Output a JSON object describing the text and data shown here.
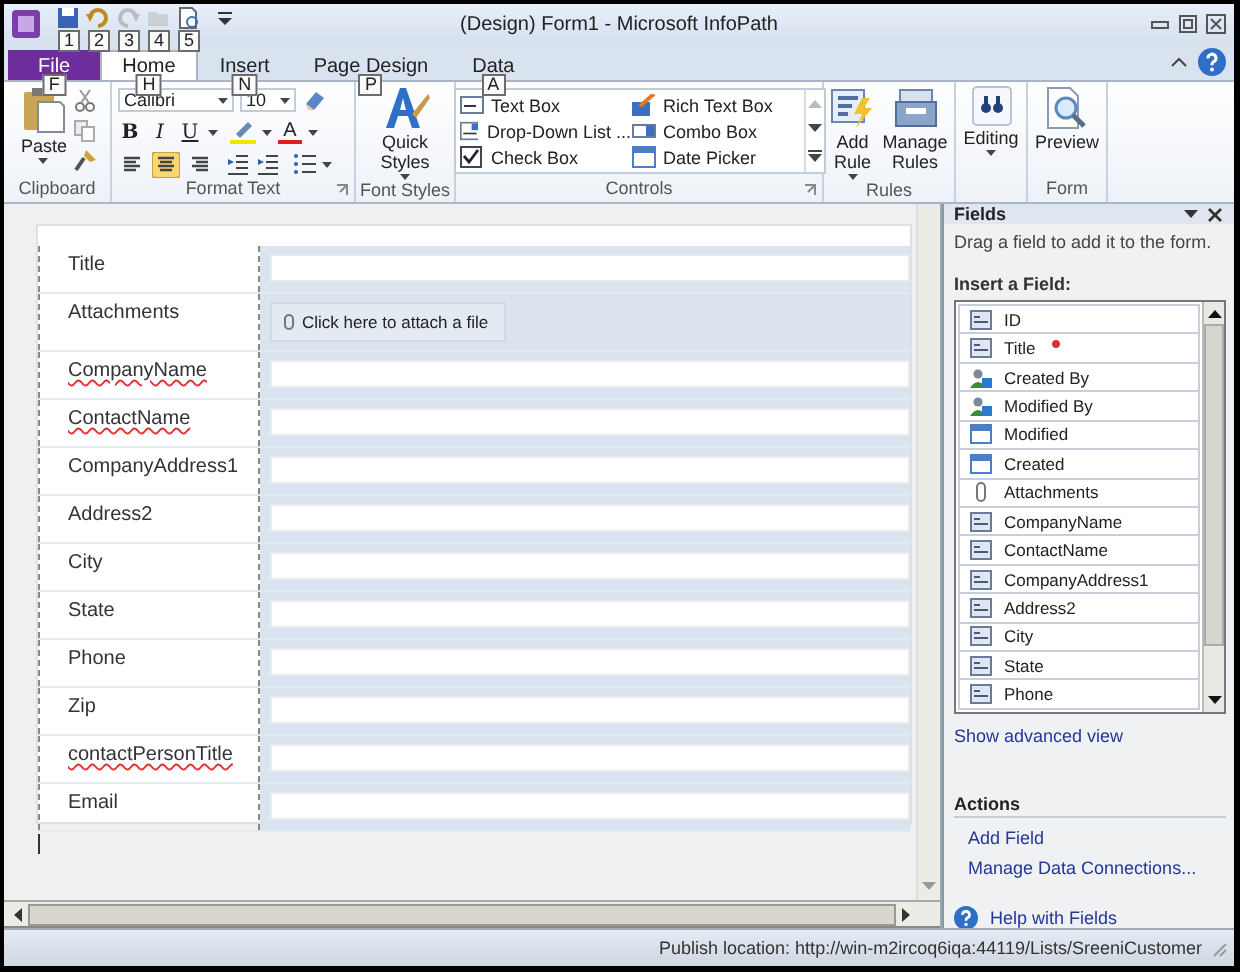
{
  "window": {
    "title": "(Design) Form1 - Microsoft InfoPath"
  },
  "quick_access": [
    {
      "kind": "save",
      "keytip": "1",
      "disabled": false
    },
    {
      "kind": "undo",
      "keytip": "2",
      "disabled": false
    },
    {
      "kind": "redo",
      "keytip": "3",
      "disabled": true
    },
    {
      "kind": "open",
      "keytip": "4",
      "disabled": true
    },
    {
      "kind": "preview",
      "keytip": "5",
      "disabled": false
    }
  ],
  "tabs": [
    {
      "label": "File",
      "keytip": "F",
      "kind": "file",
      "selected": false
    },
    {
      "label": "Home",
      "keytip": "H",
      "kind": "tab",
      "selected": true
    },
    {
      "label": "Insert",
      "keytip": "N",
      "kind": "tab",
      "selected": false
    },
    {
      "label": "Page Design",
      "keytip": "P",
      "kind": "tab",
      "selected": false
    },
    {
      "label": "Data",
      "keytip": "A",
      "kind": "tab",
      "selected": false
    }
  ],
  "clipboard": {
    "label": "Clipboard",
    "paste": "Paste"
  },
  "format_text": {
    "label": "Format Text",
    "font": "Calibri",
    "size": "10",
    "bold": "B",
    "italic": "I",
    "underline": "U",
    "font_color": "A",
    "align": [
      {
        "selected": false
      },
      {
        "selected": true
      },
      {
        "selected": false
      }
    ]
  },
  "font_styles": {
    "label": "Font Styles",
    "button": "Quick Styles"
  },
  "controls": {
    "label": "Controls",
    "items": [
      {
        "label": "Text Box",
        "kind": "text"
      },
      {
        "label": "Rich Text Box",
        "kind": "rich"
      },
      {
        "label": "Drop-Down List ...",
        "kind": "dropdown"
      },
      {
        "label": "Combo Box",
        "kind": "combo"
      },
      {
        "label": "Check Box",
        "kind": "check"
      },
      {
        "label": "Date Picker",
        "kind": "date"
      }
    ]
  },
  "rules": {
    "label": "Rules",
    "buttons": [
      {
        "label": "Add Rule",
        "kind": "add"
      },
      {
        "label": "Manage Rules",
        "kind": "manage"
      }
    ]
  },
  "editing": {
    "button": "Editing"
  },
  "form_group": {
    "label": "Form",
    "button": "Preview"
  },
  "form": {
    "rows": [
      {
        "label": "Title",
        "kind": "text",
        "misspelled": false
      },
      {
        "label": "Attachments",
        "kind": "attachment",
        "misspelled": false,
        "action": "Click here to attach a file"
      },
      {
        "label": "CompanyName",
        "kind": "text",
        "misspelled": true
      },
      {
        "label": "ContactName",
        "kind": "text",
        "misspelled": true
      },
      {
        "label": "CompanyAddress1",
        "kind": "text",
        "misspelled": false
      },
      {
        "label": "Address2",
        "kind": "text",
        "misspelled": false
      },
      {
        "label": "City",
        "kind": "text",
        "misspelled": false
      },
      {
        "label": "State",
        "kind": "text",
        "misspelled": false
      },
      {
        "label": "Phone",
        "kind": "text",
        "misspelled": false
      },
      {
        "label": "Zip",
        "kind": "text",
        "misspelled": false
      },
      {
        "label": "contactPersonTitle",
        "kind": "text",
        "misspelled": true
      },
      {
        "label": "Email",
        "kind": "text",
        "misspelled": false
      }
    ]
  },
  "fields_pane": {
    "title": "Fields",
    "hint": "Drag a field to add it to the form.",
    "insert_label": "Insert a Field:",
    "fields": [
      {
        "name": "ID",
        "kind": "text",
        "required": false
      },
      {
        "name": "Title",
        "kind": "text",
        "required": true
      },
      {
        "name": "Created By",
        "kind": "user",
        "required": false
      },
      {
        "name": "Modified By",
        "kind": "user",
        "required": false
      },
      {
        "name": "Modified",
        "kind": "date",
        "required": false
      },
      {
        "name": "Created",
        "kind": "date",
        "required": false
      },
      {
        "name": "Attachments",
        "kind": "attachment",
        "required": false
      },
      {
        "name": "CompanyName",
        "kind": "text",
        "required": false
      },
      {
        "name": "ContactName",
        "kind": "text",
        "required": false
      },
      {
        "name": "CompanyAddress1",
        "kind": "text",
        "required": false
      },
      {
        "name": "Address2",
        "kind": "text",
        "required": false
      },
      {
        "name": "City",
        "kind": "text",
        "required": false
      },
      {
        "name": "State",
        "kind": "text",
        "required": false
      },
      {
        "name": "Phone",
        "kind": "text",
        "required": false
      }
    ],
    "show_advanced": "Show advanced view",
    "actions_title": "Actions",
    "actions": [
      "Add Field",
      "Manage Data Connections..."
    ],
    "help": "Help with Fields"
  },
  "status_bar": {
    "text": "Publish location: http://win-m2ircoq6iqa:44119/Lists/SreeniCustomer"
  }
}
